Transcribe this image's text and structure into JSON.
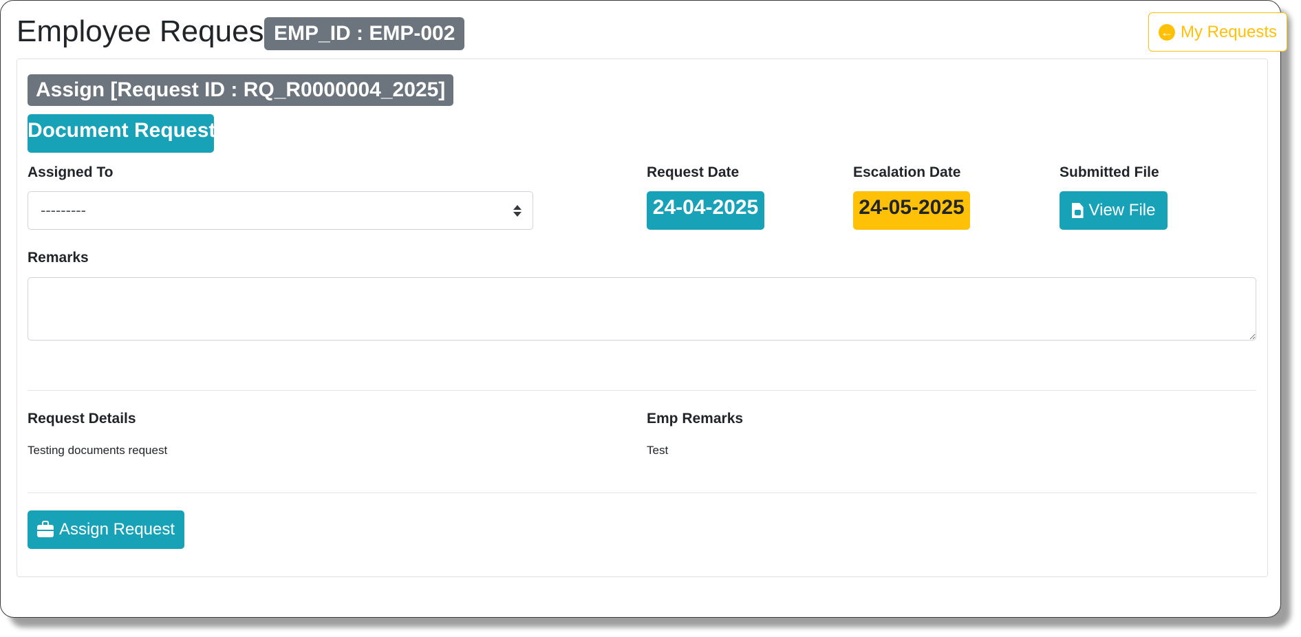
{
  "header": {
    "title": "Employee Request",
    "emp_badge": "EMP_ID : EMP-002",
    "my_requests_label": "My Requests"
  },
  "request": {
    "assign_heading": "Assign [Request ID : RQ_R0000004_2025]",
    "type_badge": "Document Request"
  },
  "form": {
    "assigned_to_label": "Assigned To",
    "assigned_to_value": "---------",
    "request_date_label": "Request Date",
    "request_date_value": "24-04-2025",
    "escalation_date_label": "Escalation Date",
    "escalation_date_value": "24-05-2025",
    "submitted_file_label": "Submitted File",
    "view_file_label": "View File",
    "remarks_label": "Remarks",
    "remarks_value": ""
  },
  "details": {
    "request_details_label": "Request Details",
    "request_details_value": "Testing documents request",
    "emp_remarks_label": "Emp Remarks",
    "emp_remarks_value": "Test"
  },
  "actions": {
    "assign_request_label": "Assign Request"
  },
  "colors": {
    "info": "#17a2b8",
    "warning": "#ffc107",
    "secondary": "#6c757d"
  },
  "icons": {
    "my_requests": "arrow-circle-left-icon",
    "view_file": "file-pdf-icon",
    "assign": "briefcase-icon",
    "select": "sort-icon"
  }
}
